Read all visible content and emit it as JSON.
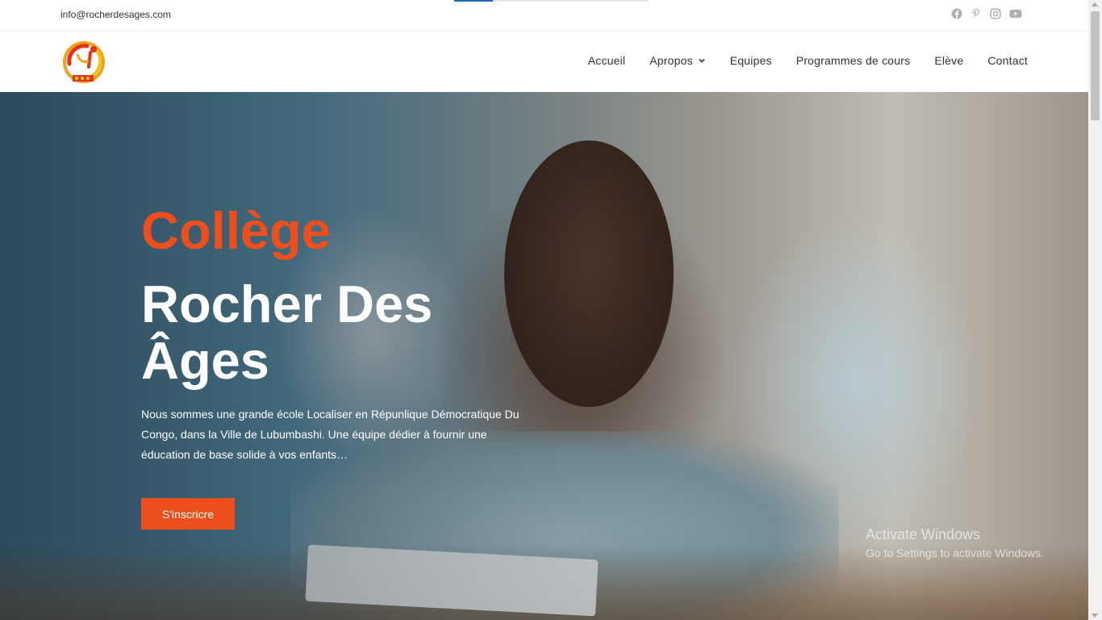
{
  "topbar": {
    "email": "info@rocherdesages.com",
    "social": [
      "facebook-icon",
      "pinterest-icon",
      "instagram-icon",
      "youtube-icon"
    ],
    "icon_color": "#b0b0b0",
    "page_load_progress": 0.2
  },
  "header": {
    "logo": "rocher-des-ages-logo",
    "nav": [
      {
        "label": "Accueil"
      },
      {
        "label": "Apropos",
        "has_dropdown": true
      },
      {
        "label": "Equipes"
      },
      {
        "label": "Programmes de cours"
      },
      {
        "label": "Elève"
      },
      {
        "label": "Contact"
      }
    ]
  },
  "hero": {
    "title_accent": "Collège",
    "title_main": "Rocher Des Âges",
    "description": "Nous sommes une grande école Localiser en Répunlique Démocratique Du Congo, dans la Ville de Lubumbashi. Une équipe dédier à fournir une éducation de base solide à vos enfants…",
    "cta_label": "S'inscricre",
    "accent_color": "#ee4e1b"
  },
  "watermark": {
    "line1": "Activate Windows",
    "line2": "Go to Settings to activate Windows."
  }
}
